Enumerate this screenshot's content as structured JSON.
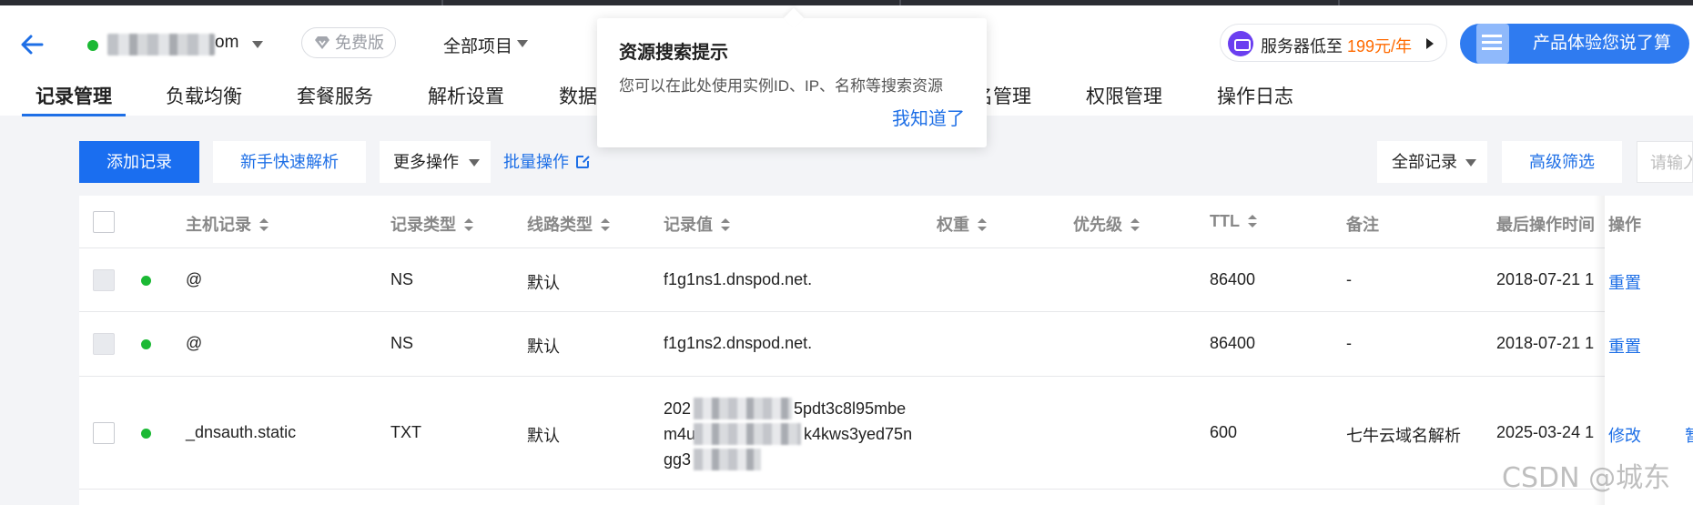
{
  "header": {
    "domain_suffix": "om",
    "free_badge": "免费版",
    "project_selector": "全部项目",
    "promo": {
      "prefix": "服务器低至 ",
      "price": "199元/年"
    },
    "experience_button": "产品体验您说了算"
  },
  "tabs": [
    {
      "label": "记录管理",
      "active": true
    },
    {
      "label": "负载均衡"
    },
    {
      "label": "套餐服务"
    },
    {
      "label": "解析设置"
    },
    {
      "label": "数据"
    },
    {
      "label": "名管理"
    },
    {
      "label": "权限管理"
    },
    {
      "label": "操作日志"
    }
  ],
  "popover": {
    "title": "资源搜索提示",
    "body": "您可以在此处使用实例ID、IP、名称等搜索资源",
    "confirm": "我知道了"
  },
  "toolbar": {
    "add_record": "添加记录",
    "quick_resolve": "新手快速解析",
    "more_actions": "更多操作",
    "batch_actions": "批量操作",
    "record_filter": "全部记录",
    "advanced_filter": "高级筛选",
    "search_placeholder": "请输入"
  },
  "table": {
    "columns": [
      "主机记录",
      "记录类型",
      "线路类型",
      "记录值",
      "权重",
      "优先级",
      "TTL",
      "备注",
      "最后操作时间",
      "操作"
    ],
    "rows": [
      {
        "host": "@",
        "type": "NS",
        "line": "默认",
        "value": "f1g1ns1.dnspod.net.",
        "ttl": "86400",
        "remark": "-",
        "time": "2018-07-21 1",
        "action1": "重置"
      },
      {
        "host": "@",
        "type": "NS",
        "line": "默认",
        "value": "f1g1ns2.dnspod.net.",
        "ttl": "86400",
        "remark": "-",
        "time": "2018-07-21 1",
        "action1": "重置"
      },
      {
        "host": "_dnsauth.static",
        "type": "TXT",
        "line": "默认",
        "value_lines": [
          "202",
          "5pdt3c8l95mbe",
          "m4u",
          "k4kws3yed75n",
          "gg3"
        ],
        "ttl": "600",
        "remark": "七牛云域名解析",
        "time": "2025-03-24 1",
        "action1": "修改",
        "action2": "暂"
      }
    ]
  },
  "watermark": "CSDN @城东",
  "colors": {
    "primary": "#1a6ef0",
    "link": "#1e6fe6",
    "status_on": "#1bb934",
    "promo_price": "#ff6a00"
  }
}
